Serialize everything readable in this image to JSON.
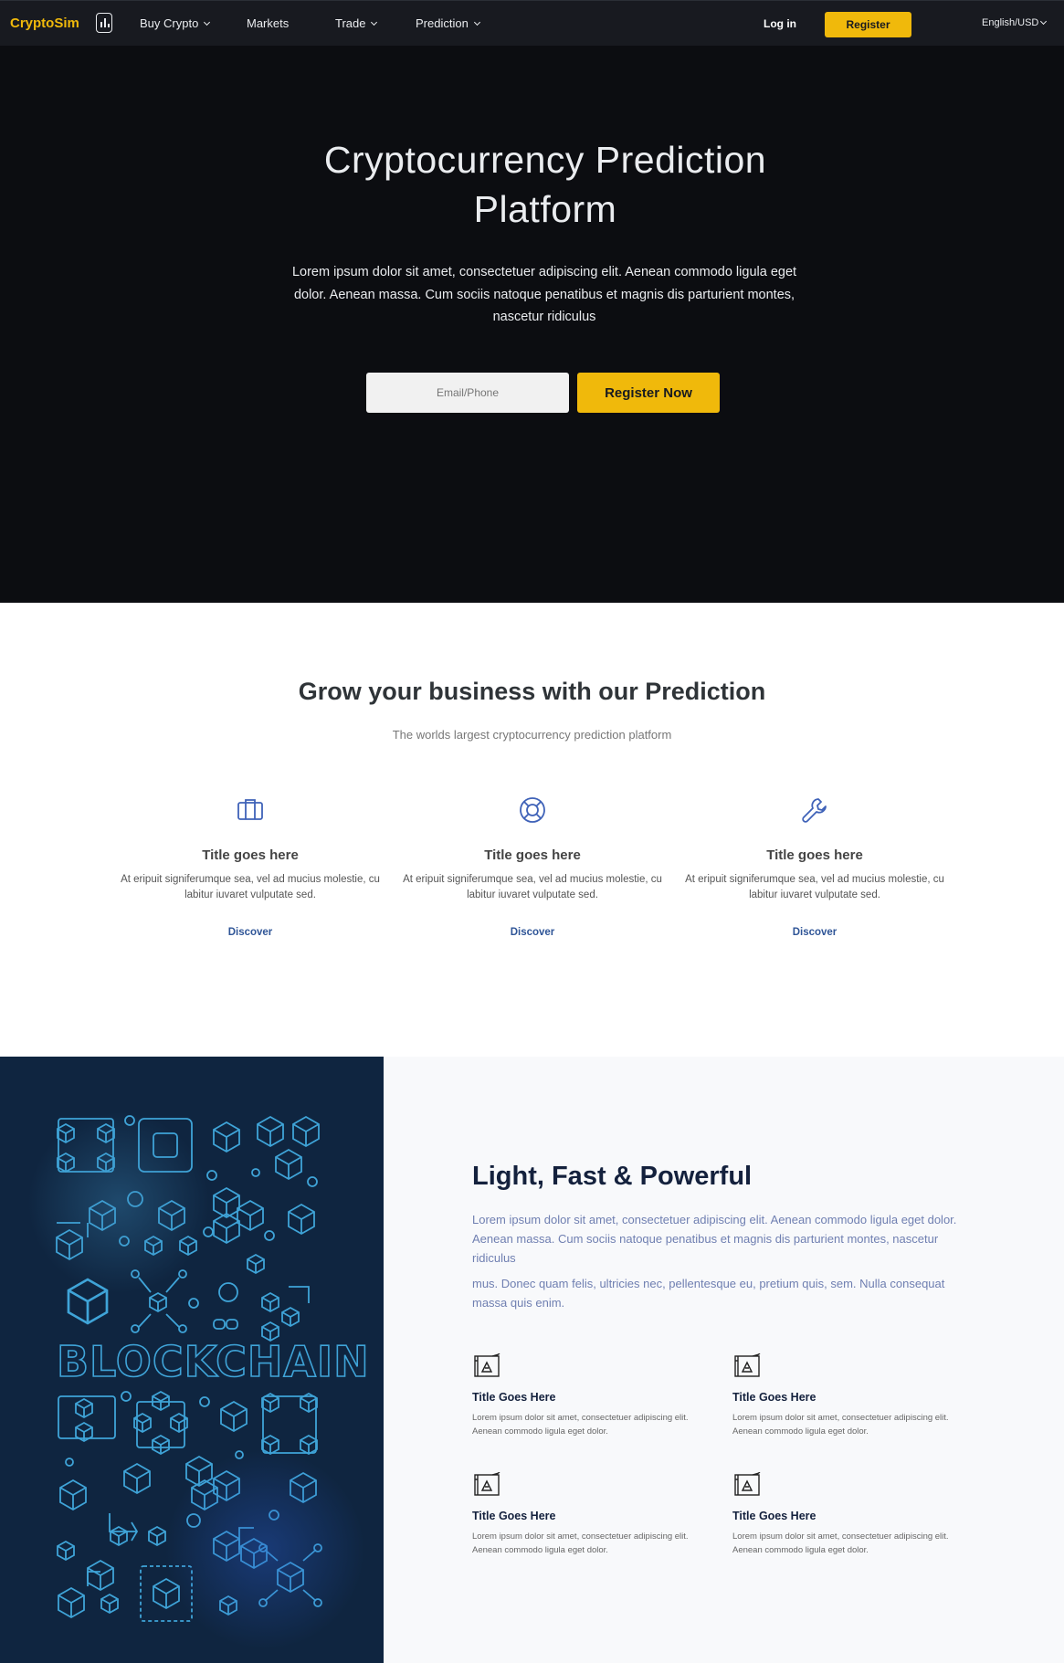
{
  "nav": {
    "brand": "CryptoSim",
    "items": [
      {
        "label": "Buy Crypto",
        "dropdown": true
      },
      {
        "label": "Markets",
        "dropdown": false
      },
      {
        "label": "Trade",
        "dropdown": true
      },
      {
        "label": "Prediction",
        "dropdown": true
      }
    ],
    "login": "Log in",
    "register": "Register",
    "language": "English/USD",
    "accent_color": "#f0b90b"
  },
  "hero": {
    "title_line1": "Cryptocurrency Prediction",
    "title_line2": "Platform",
    "text": "Lorem ipsum dolor sit amet, consectetuer adipiscing elit. Aenean commodo ligula eget dolor. Aenean massa. Cum sociis natoque penatibus et magnis dis parturient montes, nascetur ridiculus",
    "input_placeholder": "Email/Phone",
    "cta": "Register Now"
  },
  "grow": {
    "title": "Grow your business with our Prediction",
    "subtitle": "The worlds largest cryptocurrency prediction platform",
    "features": [
      {
        "icon": "briefcase-icon",
        "title": "Title goes here",
        "text": "At eripuit signiferumque sea, vel ad mucius molestie, cu labitur iuvaret vulputate sed.",
        "link": "Discover"
      },
      {
        "icon": "lifebuoy-icon",
        "title": "Title goes here",
        "text": "At eripuit signiferumque sea, vel ad mucius molestie, cu labitur iuvaret vulputate sed.",
        "link": "Discover"
      },
      {
        "icon": "wrench-icon",
        "title": "Title goes here",
        "text": "At eripuit signiferumque sea, vel ad mucius molestie, cu labitur iuvaret vulputate sed.",
        "link": "Discover"
      }
    ]
  },
  "blockchain": {
    "illustration_label": "BLOCKCHAIN"
  },
  "powerful": {
    "title": "Light, Fast & Powerful",
    "p1": "Lorem ipsum dolor sit amet, consectetuer adipiscing elit. Aenean commodo ligula eget dolor. Aenean massa. Cum sociis natoque penatibus et magnis dis parturient montes, nascetur ridiculus",
    "p2": "mus. Donec quam felis, ultricies nec, pellentesque eu, pretium quis, sem. Nulla consequat massa quis enim.",
    "items": [
      {
        "icon": "blueprint-icon",
        "title": "Title Goes Here",
        "text": "Lorem ipsum dolor sit amet, consectetuer adipiscing elit. Aenean commodo ligula eget dolor."
      },
      {
        "icon": "blueprint-icon",
        "title": "Title Goes Here",
        "text": "Lorem ipsum dolor sit amet, consectetuer adipiscing elit. Aenean commodo ligula eget dolor."
      },
      {
        "icon": "blueprint-icon",
        "title": "Title Goes Here",
        "text": "Lorem ipsum dolor sit amet, consectetuer adipiscing elit. Aenean commodo ligula eget dolor."
      },
      {
        "icon": "blueprint-icon",
        "title": "Title Goes Here",
        "text": "Lorem ipsum dolor sit amet, consectetuer adipiscing elit. Aenean commodo ligula eget dolor."
      }
    ]
  }
}
